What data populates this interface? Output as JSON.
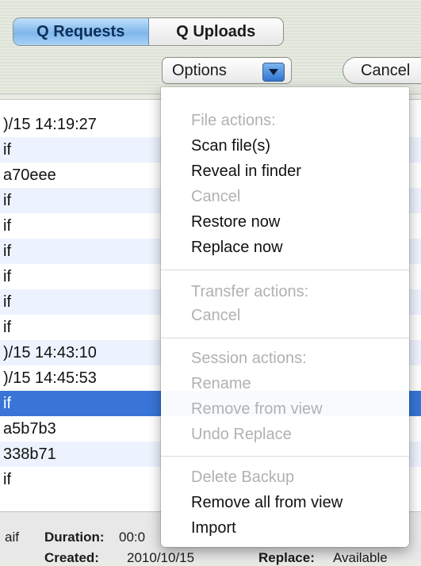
{
  "toolbar": {
    "tabs": [
      {
        "label": "Q Requests",
        "active": true
      },
      {
        "label": "Q Uploads",
        "active": false
      }
    ],
    "options_label": "Options",
    "cancel_label": "Cancel"
  },
  "list": {
    "rows": [
      {
        "text": ")/15 14:19:27"
      },
      {
        "text": "if"
      },
      {
        "text": "a70eee"
      },
      {
        "text": "if"
      },
      {
        "text": "if"
      },
      {
        "text": "if"
      },
      {
        "text": "if"
      },
      {
        "text": "if"
      },
      {
        "text": "if"
      },
      {
        "text": ")/15 14:43:10"
      },
      {
        "text": ")/15 14:45:53"
      },
      {
        "text": "if",
        "selected": true
      },
      {
        "text": "a5b7b3"
      },
      {
        "text": "338b71"
      },
      {
        "text": "if"
      }
    ]
  },
  "footer": {
    "name_fragment": "aif",
    "duration_label": "Duration:",
    "duration_value": "00:0",
    "created_label": "Created:",
    "created_value": "2010/10/15",
    "replace_label": "Replace:",
    "replace_value": "Available"
  },
  "menu": {
    "file_header": "File actions:",
    "scan": "Scan file(s)",
    "reveal": "Reveal in finder",
    "cancel_file": "Cancel",
    "restore": "Restore now",
    "replace": "Replace now",
    "transfer_header": "Transfer actions:",
    "cancel_transfer": "Cancel",
    "session_header": "Session actions:",
    "rename": "Rename",
    "remove_view": "Remove from view",
    "undo_replace": "Undo Replace",
    "delete_backup": "Delete Backup",
    "remove_all": "Remove all from view",
    "import": "Import"
  },
  "colors": {
    "selection": "#3875d7",
    "alt_row": "#edf3fe",
    "accent": "#2f74d0"
  }
}
